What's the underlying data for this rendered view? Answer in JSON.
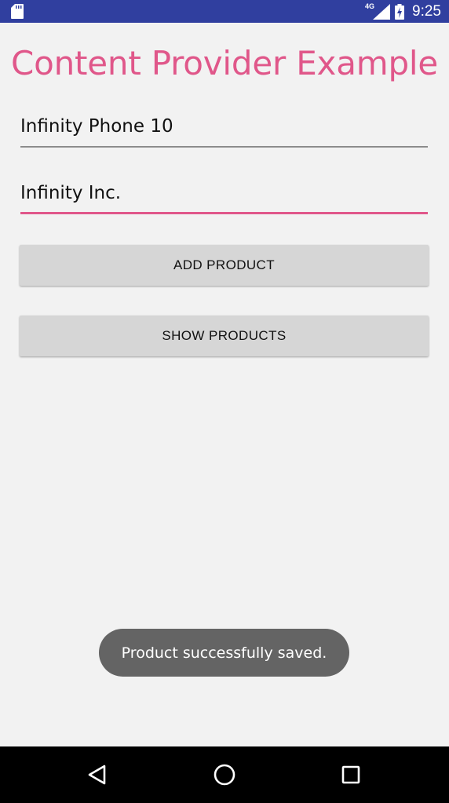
{
  "status_bar": {
    "network": "4G",
    "time": "9:25",
    "icons": [
      "sd-card-icon",
      "signal-icon",
      "battery-charging-icon"
    ]
  },
  "title": "Content Provider Example",
  "form": {
    "product_name": "Infinity Phone 10",
    "manufacturer": "Infinity Inc."
  },
  "buttons": {
    "add": "ADD PRODUCT",
    "show": "SHOW PRODUCTS"
  },
  "toast": "Product successfully saved.",
  "nav": {
    "icons": [
      "back-icon",
      "home-icon",
      "recents-icon"
    ]
  },
  "colors": {
    "status_bar": "#303f9f",
    "accent": "#e0578a",
    "background": "#f2f2f2",
    "button": "#d6d6d6",
    "toast": "#646464"
  }
}
